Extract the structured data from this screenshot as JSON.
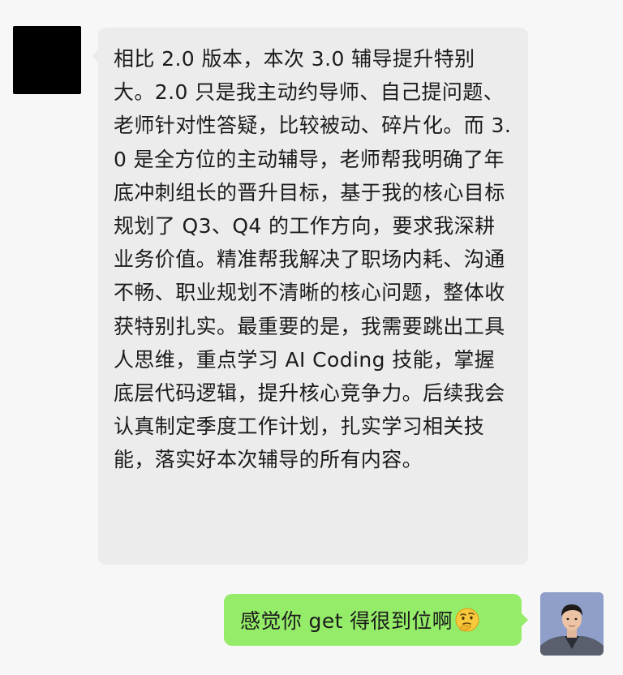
{
  "chat": {
    "incoming": {
      "text": "相比 2.0 版本，本次 3.0 辅导提升特别大。2.0 只是我主动约导师、自己提问题、老师针对性答疑，比较被动、碎片化。而 3.0 是全方位的主动辅导，老师帮我明确了年底冲刺组长的晋升目标，基于我的核心目标规划了 Q3、Q4 的工作方向，要求我深耕业务价值。精准帮我解决了职场内耗、沟通不畅、职业规划不清晰的核心问题，整体收获特别扎实。最重要的是，我需要跳出工具人思维，重点学习 AI Coding 技能，掌握底层代码逻辑，提升核心竞争力。后续我会认真制定季度工作计划，扎实学习相关技能，落实好本次辅导的所有内容。"
    },
    "outgoing": {
      "text": "感觉你 get 得很到位啊",
      "emoji": "thinking-emoji"
    }
  },
  "colors": {
    "background": "#f7f7f7",
    "incoming_bubble": "#ececec",
    "outgoing_bubble": "#95ec69",
    "incoming_avatar": "#000000"
  }
}
